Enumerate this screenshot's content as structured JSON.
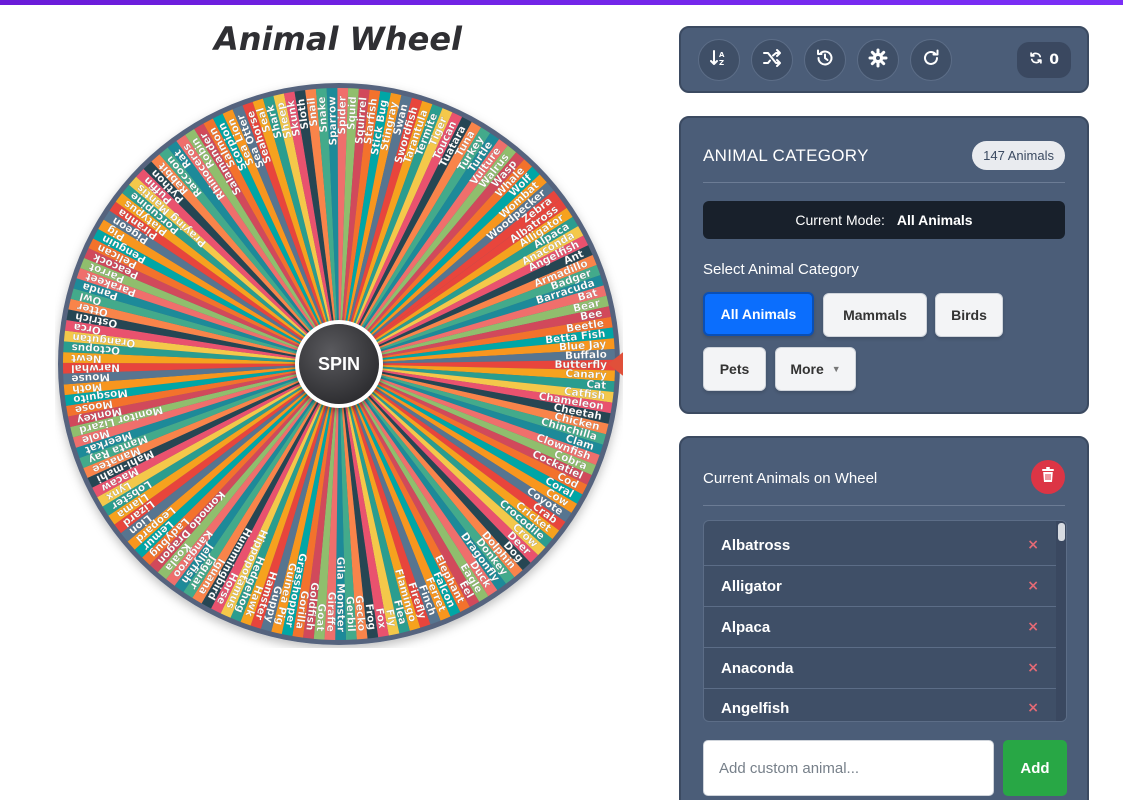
{
  "title": "Animal Wheel",
  "wheel": {
    "spin_label": "SPIN",
    "animals": [
      "Albatross",
      "Alligator",
      "Alpaca",
      "Anaconda",
      "Angelfish",
      "Ant",
      "Armadillo",
      "Badger",
      "Barracuda",
      "Bat",
      "Bear",
      "Bee",
      "Beetle",
      "Betta Fish",
      "Blue Jay",
      "Buffalo",
      "Butterfly",
      "Canary",
      "Cat",
      "Catfish",
      "Chameleon",
      "Cheetah",
      "Chicken",
      "Chinchilla",
      "Clam",
      "Clownfish",
      "Cobra",
      "Cockatiel",
      "Cod",
      "Coral",
      "Cow",
      "Coyote",
      "Crab",
      "Cricket",
      "Crocodile",
      "Crow",
      "Deer",
      "Dog",
      "Dolphin",
      "Donkey",
      "Dragonfly",
      "Duck",
      "Eagle",
      "Eel",
      "Elephant",
      "Falcon",
      "Ferret",
      "Finch",
      "Firefly",
      "Flamingo",
      "Flea",
      "Fly",
      "Fox",
      "Frog",
      "Gecko",
      "Gerbil",
      "Gila Monster",
      "Giraffe",
      "Goat",
      "Goldfish",
      "Gorilla",
      "Grasshopper",
      "Guinea Pig",
      "Guppy",
      "Hamster",
      "Hawk",
      "Hedgehog",
      "Hippopotamus",
      "Horse",
      "Hummingbird",
      "Iguana",
      "Jaguar",
      "Jellyfish",
      "Kangaroo",
      "Koala",
      "Komodo Dragon",
      "Ladybug",
      "Lemur",
      "Leopard",
      "Lion",
      "Lizard",
      "Llama",
      "Lobster",
      "Lynx",
      "Macaw",
      "Mahi-mahi",
      "Manatee",
      "Manta Ray",
      "Meerkat",
      "Mole",
      "Monitor Lizard",
      "Monkey",
      "Moose",
      "Mosquito",
      "Moth",
      "Mouse",
      "Narwhal",
      "Newt",
      "Octopus",
      "Orangutan",
      "Orca",
      "Ostrich",
      "Otter",
      "Owl",
      "Panda",
      "Parakeet",
      "Parrot",
      "Peacock",
      "Pelican",
      "Penguin",
      "Pig",
      "Pigeon",
      "Piranha",
      "Platypus",
      "Porcupine",
      "Praying Mantis",
      "Puffin",
      "Python",
      "Rabbit",
      "Raccoon",
      "Rat",
      "Rhinoceros",
      "Robin",
      "Salamander",
      "Salmon",
      "Scorpion",
      "Sea Lion",
      "Sea Otter",
      "Seahorse",
      "Seal",
      "Shark",
      "Sheep",
      "Skunk",
      "Sloth",
      "Snail",
      "Snake",
      "Sparrow",
      "Spider",
      "Squid",
      "Squirrel",
      "Starfish",
      "Stick Bug",
      "Stingray",
      "Swan",
      "Swordfish",
      "Tarantula",
      "Termite",
      "Tiger",
      "Toucan",
      "Tuatara",
      "Tuna",
      "Turkey",
      "Turtle",
      "Vulture",
      "Walrus",
      "Wasp",
      "Whale",
      "Wolf",
      "Wombat",
      "Woodpecker",
      "Zebra"
    ],
    "colors": [
      "#e8453c",
      "#f6a21e",
      "#2a9d8f",
      "#f4c84a",
      "#e9526e",
      "#264653",
      "#f9844a",
      "#43aa8b",
      "#1d8a99",
      "#ef6f6c",
      "#90be6d",
      "#d1495b",
      "#f3722c",
      "#00a6a6",
      "#f8961e",
      "#577590"
    ]
  },
  "toolbar": {
    "buttons": [
      {
        "icon": "sort-alpha-icon"
      },
      {
        "icon": "shuffle-icon"
      },
      {
        "icon": "history-icon"
      },
      {
        "icon": "gear-icon"
      },
      {
        "icon": "redo-icon"
      }
    ],
    "spin_count": "0"
  },
  "category": {
    "heading": "ANIMAL CATEGORY",
    "count_badge": "147 Animals",
    "mode_label": "Current Mode:",
    "mode_value": "All Animals",
    "select_label": "Select Animal Category",
    "buttons": [
      "All Animals",
      "Mammals",
      "Birds",
      "Pets",
      "More"
    ],
    "active": "All Animals"
  },
  "list": {
    "heading": "Current Animals on Wheel",
    "items": [
      "Albatross",
      "Alligator",
      "Alpaca",
      "Anaconda",
      "Angelfish"
    ],
    "remove_symbol": "×",
    "input_placeholder": "Add custom animal...",
    "add_label": "Add"
  }
}
